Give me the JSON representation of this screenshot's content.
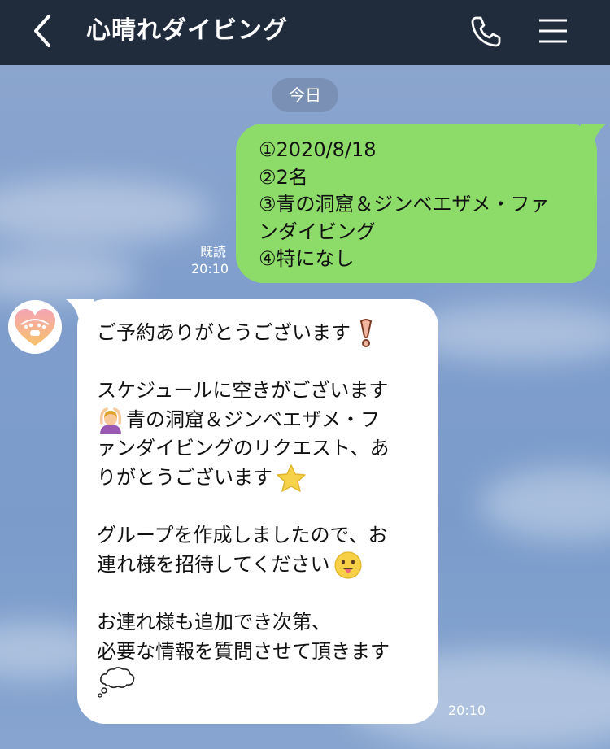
{
  "header": {
    "title": "心晴れダイビング",
    "back_icon": "chevron-left-icon",
    "call_icon": "phone-icon",
    "menu_icon": "hamburger-menu-icon",
    "background": "#202b3b"
  },
  "date_separator": "今日",
  "sent_message": {
    "lines": [
      "①2020/8/18",
      "②2名",
      "③青の洞窟＆ジンベエザメ・ファ",
      "ンダイビング",
      "④特になし"
    ],
    "read_label": "既読",
    "time": "20:10",
    "bubble_color": "#8ddc6a"
  },
  "received_message": {
    "avatar": "shop-logo-avatar",
    "lines": [
      "ご予約ありがとうございます",
      "",
      "スケジュールに空きがございます",
      "青の洞窟＆ジンベエザメ・フ",
      "ァンダイビングのリクエスト、あ",
      "りがとうございます",
      "",
      "グループを作成しましたので、お",
      "連れ様を招待してください",
      "",
      "お連れ様も追加でき次第、",
      "必要な情報を質問させて頂きます"
    ],
    "emojis": [
      "exclamation-mark-icon",
      "person-gesturing-ok-icon",
      "star-icon",
      "tongue-face-icon",
      "thought-balloon-icon"
    ],
    "time": "20:10",
    "bubble_color": "#ffffff"
  }
}
